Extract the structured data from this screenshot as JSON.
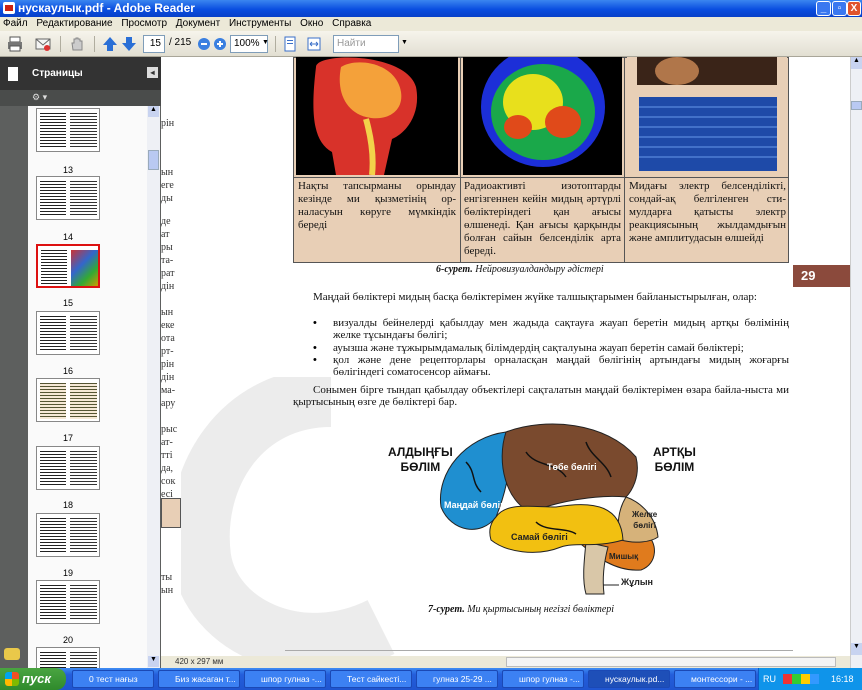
{
  "window": {
    "title": "нускаулык.pdf - Adobe Reader",
    "min": "_",
    "max": "▫",
    "close": "X"
  },
  "menu": [
    "Файл",
    "Редактирование",
    "Просмотр",
    "Документ",
    "Инструменты",
    "Окно",
    "Справка"
  ],
  "toolbar": {
    "page_current": "15",
    "page_total": "/ 215",
    "zoom": "100%",
    "find_placeholder": "Найти"
  },
  "panel": {
    "title": "Страницы",
    "collapse": "◂",
    "options": "⚙ ▾",
    "page_labels": [
      "13",
      "14",
      "15",
      "16",
      "17",
      "18",
      "19",
      "20"
    ]
  },
  "left_page_fragments": [
    "рiн",
    "ын",
    "еге",
    "ды",
    "де",
    "ат",
    "ры",
    "та-",
    "рат",
    "дiн",
    "ын",
    "еке",
    "ота",
    "рт-",
    "рiн",
    "дiн",
    "ма-",
    "ару",
    "рыс",
    "ат-",
    "тті",
    "да,",
    "сок",
    "есі",
    "ты",
    "ын"
  ],
  "document": {
    "page_number": "29",
    "table_cells": [
      "Нақты тапсырманы орындау кезінде ми қызметінің ор-наласуын көруге мүмкіндік береді",
      "Радиоактивті изотоптарды енгізгеннен кейін мидың әртүрлі бөліктеріндегі қан ағысы өлшенеді. Қан ағысы қарқынды болған сайын белсенділік арта береді.",
      "Мидағы электр белсенділікті, сондай-ақ белгіленген сти-мулдарға қатысты электр реакциясының жылдамдығын және амплитудасын өлшейді"
    ],
    "fig6_caption_bold": "6-сурет.",
    "fig6_caption_text": " Нейровизуалдандыру әдістері",
    "para1": "Маңдай бөліктері мидың басқа бөліктерімен жүйке талшықтарымен байланыстырылған, олар:",
    "bullets": [
      "визуалды бейнелерді қабылдау мен жадыда сақтауға жауап беретін мидың артқы бөлімінің желке тұсындағы бөлігі;",
      "ауызша және тұжырымдамалық білімдердің сақталуына жауап беретін самай бөліктері;",
      "қол және дене рецепторлары орналасқан маңдай бөлігінің артындағы мидың жоғарғы бөлігіндегі соматосенсор аймағы."
    ],
    "para2": "Сонымен бірге тындап қабылдау объектілері сақталатын маңдай бөліктерімен өзара байла-ныста ми қыртысының өзге де бөліктері бар.",
    "brain_labels": {
      "front1": "АЛДЫҢҒЫ",
      "front2": "БӨЛІМ",
      "back1": "АРТҚЫ",
      "back2": "БӨЛІМ",
      "frontal": "Маңдай бөлігі",
      "parietal": "Төбе бөлігі",
      "temporal": "Самай бөлігі",
      "occipital1": "Желке",
      "occipital2": "бөлігі",
      "cerebellum": "Мишық",
      "spine": "Жұлын"
    },
    "fig7_caption_bold": "7-сурет.",
    "fig7_caption_text": " Ми қыртысының негізгі бөліктері",
    "colors": {
      "table_bg": "#e8cfb6",
      "frontal": "#1f8fd0",
      "parietal": "#7a4a2e",
      "temporal": "#f2c011",
      "occipital": "#d6b27a",
      "cerebellum": "#e07b1d",
      "page_tab": "#8b4a3c"
    }
  },
  "status": {
    "page_size": "420 x 297 мм"
  },
  "taskbar": {
    "start": "пуск",
    "tasks": [
      "0 тест нағыз",
      "Биз жасаган т...",
      "шпор гулназ -...",
      "Тест сайкестi...",
      "гулназ 25-29 ...",
      "шпор гулназ -...",
      "нускаулык.pd...",
      "монтессори - ..."
    ],
    "lang": "RU",
    "clock": "16:18"
  }
}
